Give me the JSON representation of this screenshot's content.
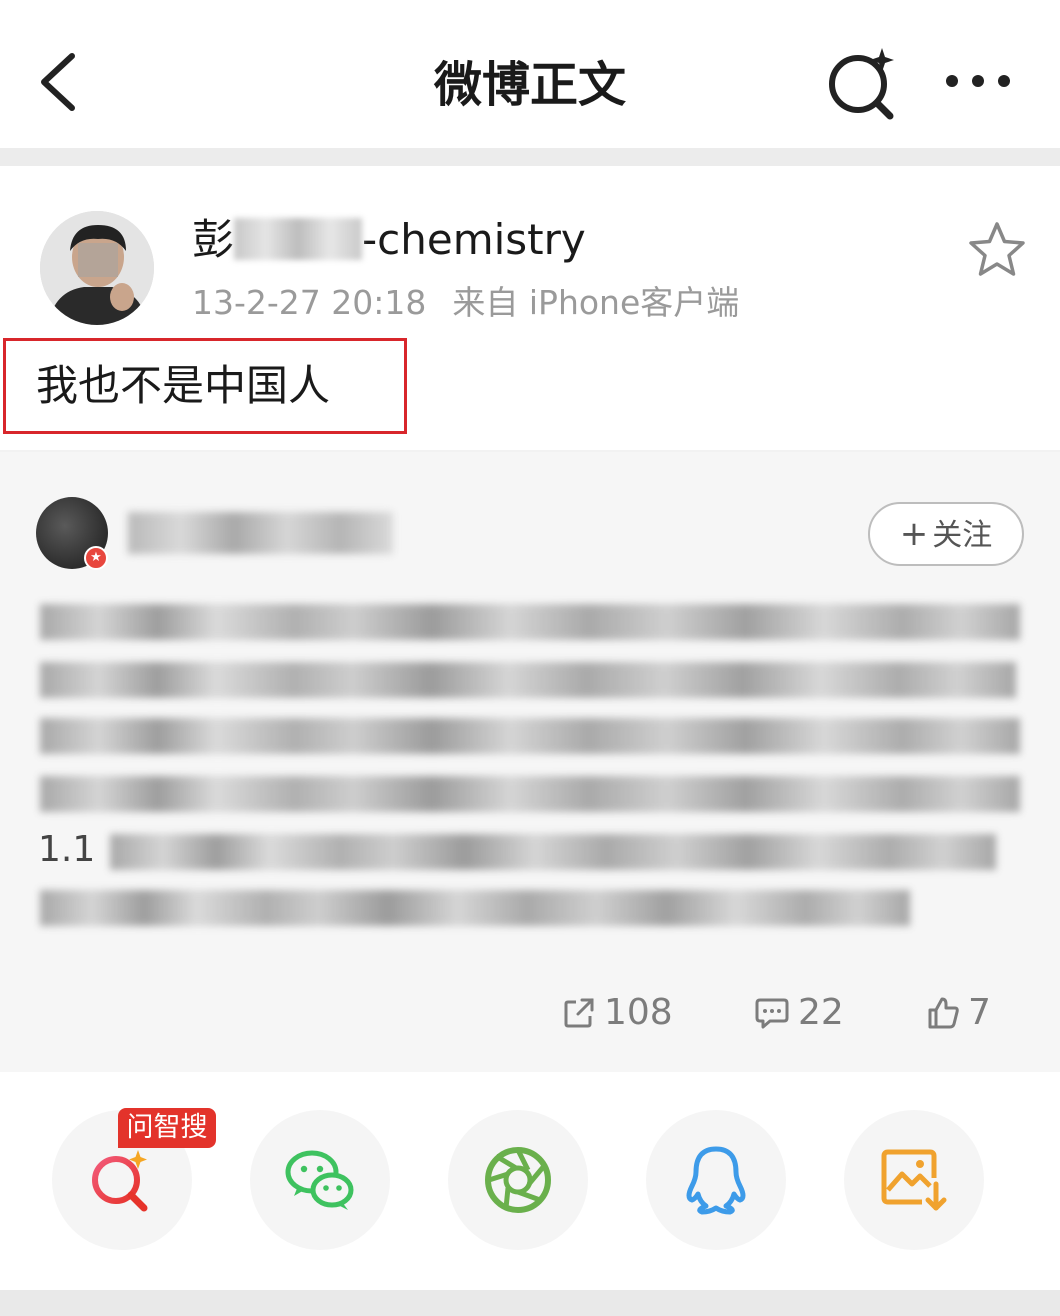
{
  "header": {
    "title": "微博正文"
  },
  "post": {
    "author_prefix": "彭",
    "author_suffix": "-chemistry",
    "timestamp": "13-2-27 20:18",
    "source": "来自 iPhone客户端",
    "text": "我也不是中国人"
  },
  "quoted": {
    "follow_label": "关注",
    "partial_line_1": "1.1",
    "stats": {
      "reposts": "108",
      "comments": "22",
      "likes": "7"
    }
  },
  "share": {
    "tag_label": "问智搜",
    "items": [
      "wenzhisou-search-icon",
      "wechat-icon",
      "moments-icon",
      "qq-icon",
      "save-image-icon"
    ]
  },
  "colors": {
    "highlight": "#d8262b",
    "tag": "#e3332b",
    "wechat": "#3ec25f",
    "moments": "#6ab04c",
    "qq": "#3d9be9",
    "save": "#f0a22e"
  }
}
